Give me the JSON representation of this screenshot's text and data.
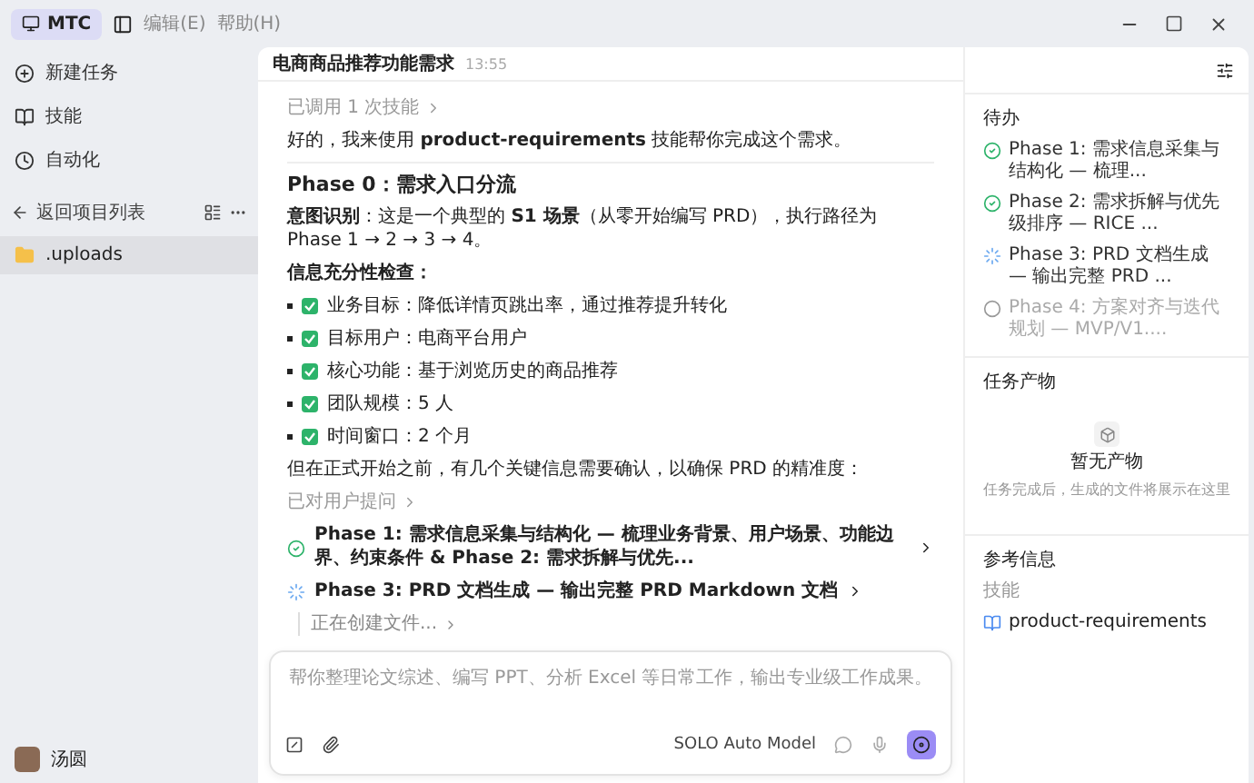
{
  "titlebar": {
    "app_name": "MTC",
    "menus": [
      "编辑(E)",
      "帮助(H)"
    ]
  },
  "sidebar": {
    "nav": [
      {
        "label": "新建任务",
        "kind": "new"
      },
      {
        "label": "技能",
        "kind": "skill"
      },
      {
        "label": "自动化",
        "kind": "auto"
      }
    ],
    "back_label": "返回项目列表",
    "files": [
      {
        "name": ".uploads",
        "selected": true
      }
    ],
    "user": {
      "name": "汤圆"
    }
  },
  "chat": {
    "title": "电商商品推荐功能需求",
    "time": "13:55",
    "skill_used": "已调用 1 次技能",
    "intro": "好的，我来使用 **product-requirements** 技能帮你完成这个需求。",
    "heading": "Phase 0：需求入口分流",
    "intent": "**意图识别**：这是一个典型的 **S1 场景**（从零开始编写 PRD），执行路径为 Phase 1 → 2 → 3 → 4。",
    "check_title": "信息充分性检查：",
    "checks": [
      {
        "text": "业务目标：降低详情页跳出率，通过推荐提升转化",
        "checked": true
      },
      {
        "text": "目标用户：电商平台用户",
        "checked": true
      },
      {
        "text": "核心功能：基于浏览历史的商品推荐",
        "checked": true
      },
      {
        "text": "团队规模：5 人",
        "checked": true
      },
      {
        "text": "时间窗口：2 个月",
        "checked": true
      }
    ],
    "confirm": "但在正式开始之前，有几个关键信息需要确认，以确保 PRD 的精准度：",
    "asked": "已对用户提问",
    "steps": [
      {
        "text": "Phase 1: 需求信息采集与结构化 — 梳理业务背景、用户场景、功能边界、约束条件 & Phase 2: 需求拆解与优先...",
        "kind": "done"
      },
      {
        "text": "Phase 3: PRD 文档生成 — 输出完整 PRD Markdown 文档",
        "kind": "running",
        "sub": "正在创建文件..."
      }
    ],
    "input": {
      "placeholder": "帮你整理论文综述、编写 PPT、分析 Excel 等日常工作，输出专业级工作成果。",
      "model": "SOLO Auto Model"
    }
  },
  "panel": {
    "todo_title": "待办",
    "todos": [
      {
        "text": "Phase 1: 需求信息采集与结构化 — 梳理...",
        "kind": "done"
      },
      {
        "text": "Phase 2: 需求拆解与优先级排序 — RICE ...",
        "kind": "done"
      },
      {
        "text": "Phase 3: PRD 文档生成 — 输出完整 PRD ...",
        "kind": "running"
      },
      {
        "text": "Phase 4: 方案对齐与迭代规划 — MVP/V1....",
        "kind": "pending"
      }
    ],
    "output_title": "任务产物",
    "empty_title": "暂无产物",
    "empty_desc": "任务完成后，生成的文件将展示在这里",
    "ref_title": "参考信息",
    "ref_label": "技能",
    "ref_skill": "product-requirements"
  }
}
